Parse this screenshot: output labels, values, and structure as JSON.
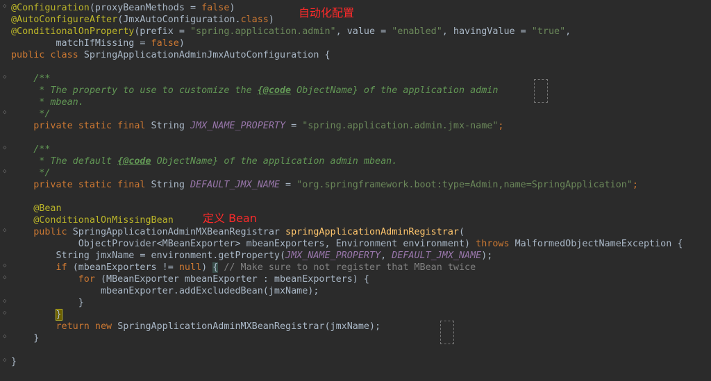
{
  "annotations": {
    "auto_config": "自动化配置",
    "define_bean": "定义 Bean"
  },
  "code": {
    "l1": [
      "@Configuration",
      "(proxyBeanMethods = ",
      "false",
      ")"
    ],
    "l2": [
      "@AutoConfigureAfter",
      "(JmxAutoConfiguration.",
      "class",
      ")"
    ],
    "l3": [
      "@ConditionalOnProperty",
      "(prefix = ",
      "\"spring.application.admin\"",
      ", value = ",
      "\"enabled\"",
      ", havingValue = ",
      "\"true\"",
      ","
    ],
    "l4": [
      "        matchIfMissing = ",
      "false",
      ")"
    ],
    "l5": [
      "public class ",
      "SpringApplicationAdminJmxAutoConfiguration {"
    ],
    "l7": "    /**",
    "l8": [
      "     * The property to use to customize the ",
      "{@code",
      " ObjectName} of the application admin"
    ],
    "l9": "     * mbean.",
    "l10": "     */",
    "l11": [
      "    private static final ",
      "String ",
      "JMX_NAME_PROPERTY",
      " = ",
      "\"spring.application.admin.jmx-name\"",
      ";"
    ],
    "l13": "    /**",
    "l14": [
      "     * The default ",
      "{@code",
      " ObjectName} of the application admin mbean."
    ],
    "l15": "     */",
    "l16": [
      "    private static final ",
      "String ",
      "DEFAULT_JMX_NAME",
      " = ",
      "\"org.springframework.boot:type=Admin,name=SpringApplication\"",
      ";"
    ],
    "l18": "    @Bean",
    "l19": "    @ConditionalOnMissingBean",
    "l20": [
      "    public ",
      "SpringApplicationAdminMXBeanRegistrar ",
      "springApplicationAdminRegistrar",
      "("
    ],
    "l21": [
      "            ObjectProvider<MBeanExporter> mbeanExporters, Environment environment) ",
      "throws ",
      "MalformedObjectNameException {"
    ],
    "l22": [
      "        String jmxName = environment.getProperty(",
      "JMX_NAME_PROPERTY",
      ", ",
      "DEFAULT_JMX_NAME",
      ");"
    ],
    "l23": [
      "        ",
      "if ",
      "(mbeanExporters != ",
      "null",
      ") ",
      "{",
      " ",
      "// Make sure to not register that MBean twice"
    ],
    "l24": [
      "            ",
      "for ",
      "(MBeanExporter mbeanExporter : mbeanExporters) {"
    ],
    "l25": "                mbeanExporter.addExcludedBean(jmxName);",
    "l26": "            }",
    "l27": [
      "        ",
      "}"
    ],
    "l28": [
      "        ",
      "return new ",
      "SpringApplicationAdminMXBeanRegistrar(jmxName);"
    ],
    "l29": "    }",
    "l31": "}"
  }
}
